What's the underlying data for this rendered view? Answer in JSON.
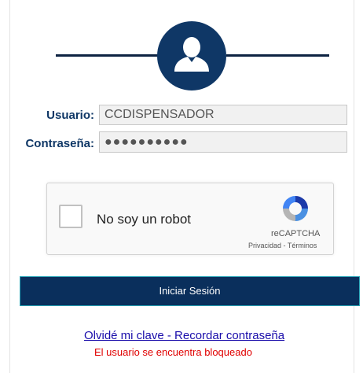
{
  "header": {
    "avatar_icon": "user-silhouette-icon"
  },
  "form": {
    "username_label": "Usuario:",
    "username_value": "CCDISPENSADOR",
    "password_label": "Contraseña:",
    "password_value": "●●●●●●●●●●"
  },
  "captcha": {
    "checkbox_label": "No soy un robot",
    "brand": "reCAPTCHA",
    "privacy": "Privacidad",
    "separator": " - ",
    "terms": "Términos",
    "logo_icon": "recaptcha-logo-icon"
  },
  "actions": {
    "login_label": "Iniciar Sesión",
    "forgot_label": "Olvidé mi clave - Recordar contraseña"
  },
  "status": {
    "error": "El usuario se encuentra bloqueado"
  },
  "colors": {
    "navy": "#0f3766",
    "button": "#0a2f5c",
    "link": "#1a0dab",
    "error": "#e00000"
  }
}
